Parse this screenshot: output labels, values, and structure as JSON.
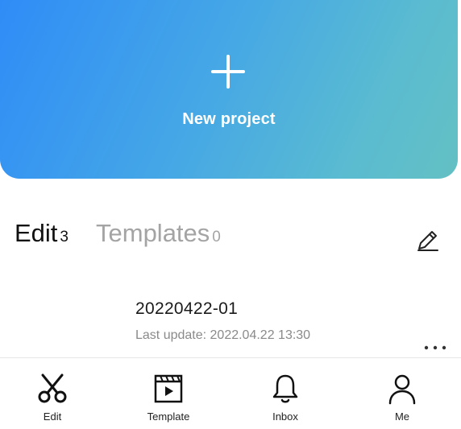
{
  "new_project": {
    "label": "New project",
    "icon": "plus-icon"
  },
  "tabs": [
    {
      "label": "Edit",
      "count": "3",
      "active": true
    },
    {
      "label": "Templates",
      "count": "0",
      "active": false
    }
  ],
  "header_actions": {
    "edit_icon": "pencil-icon"
  },
  "project": {
    "name": "20220422-01",
    "last_update": "Last update: 2022.04.22 13:30",
    "more_icon": "more-horizontal-icon"
  },
  "bottom_nav": [
    {
      "label": "Edit",
      "icon": "scissors-icon"
    },
    {
      "label": "Template",
      "icon": "template-icon"
    },
    {
      "label": "Inbox",
      "icon": "bell-icon"
    },
    {
      "label": "Me",
      "icon": "person-icon"
    }
  ],
  "colors": {
    "gradient_start": "#2f8cf7",
    "gradient_end": "#63c0c3",
    "active_tab": "#111111",
    "inactive_tab": "#a4a4a4"
  }
}
